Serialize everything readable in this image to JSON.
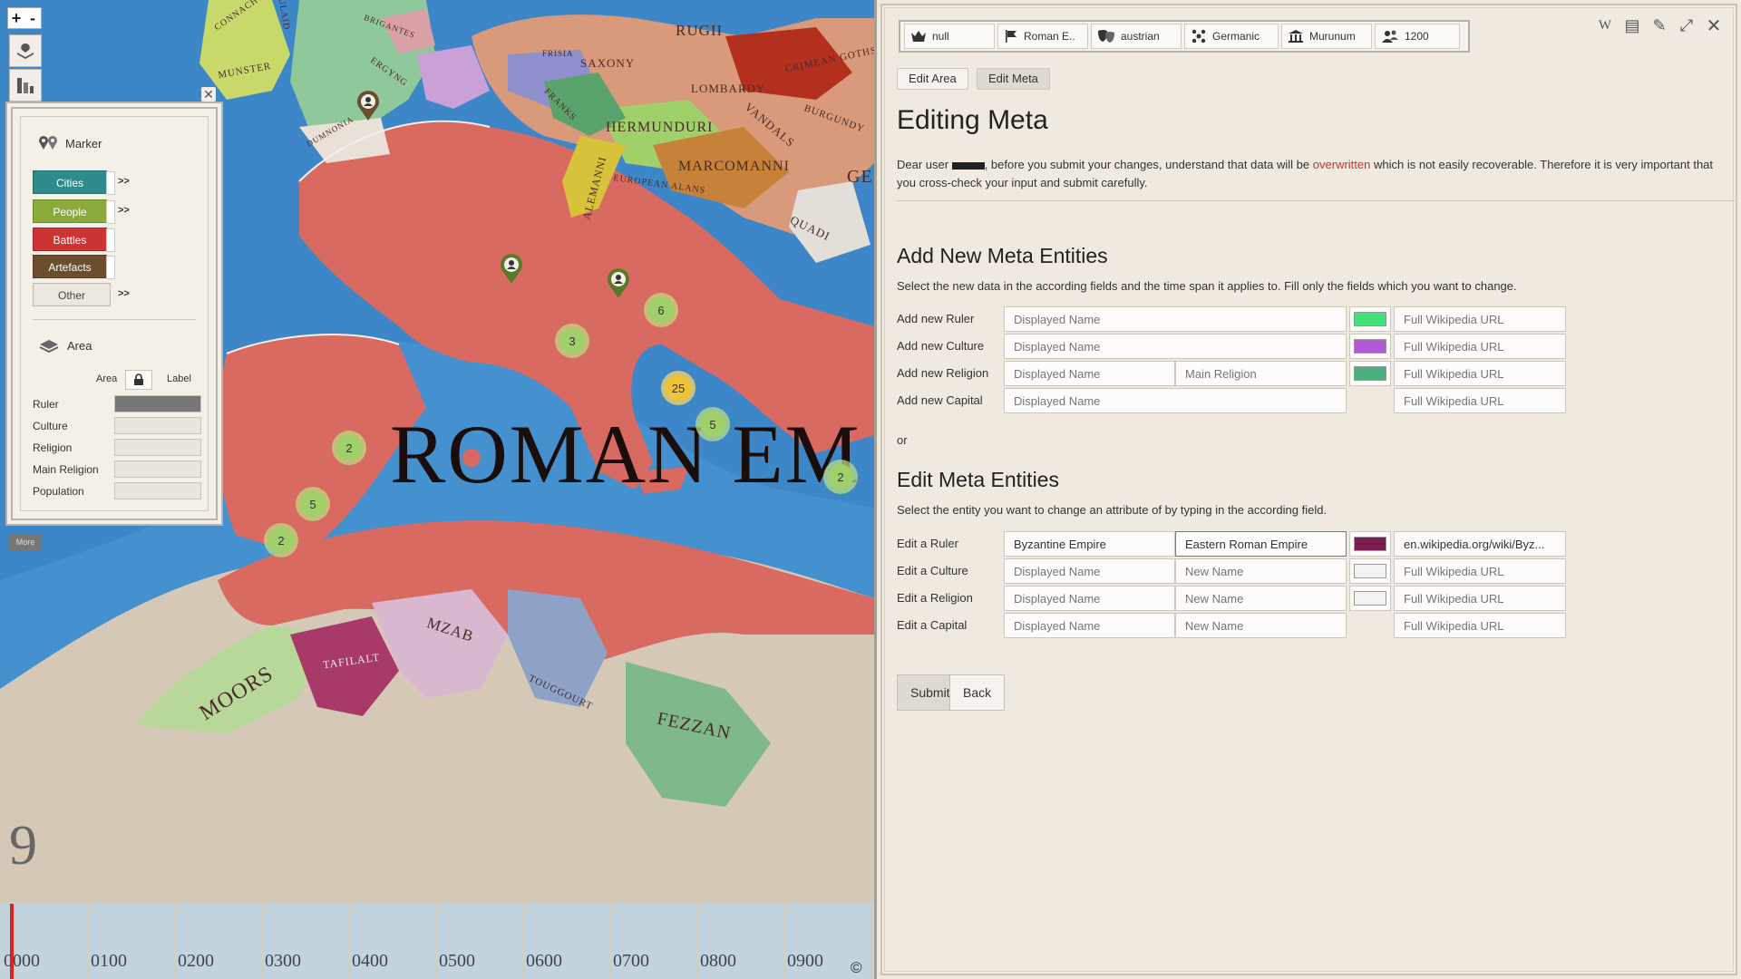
{
  "map": {
    "zoom_in": "+",
    "zoom_out": "-",
    "labels": [
      {
        "text": "ROMAN EM"
      },
      {
        "text": "RUGII"
      },
      {
        "text": "SAXONY"
      },
      {
        "text": "LOMBARDY"
      },
      {
        "text": "CRIMEAN GOTHS"
      },
      {
        "text": "HERMUNDURI"
      },
      {
        "text": "VANDALS"
      },
      {
        "text": "BURGUNDY"
      },
      {
        "text": "MARCOMANNI"
      },
      {
        "text": "ALEMANNI"
      },
      {
        "text": "EUROPEAN ALANS"
      },
      {
        "text": "QUADI"
      },
      {
        "text": "FRANKS"
      },
      {
        "text": "FRISIA"
      },
      {
        "text": "ERGYNG"
      },
      {
        "text": "MUNSTER"
      },
      {
        "text": "CONNACHT"
      },
      {
        "text": "BRIGANTES"
      },
      {
        "text": "DUMNONIA"
      },
      {
        "text": "ULAID"
      },
      {
        "text": "GE"
      },
      {
        "text": "MZAB"
      },
      {
        "text": "TAFILALT"
      },
      {
        "text": "MOORS"
      },
      {
        "text": "TOUGGOURT"
      },
      {
        "text": "FEZZAN"
      }
    ],
    "clusters": [
      {
        "count": "6"
      },
      {
        "count": "3"
      },
      {
        "count": "25"
      },
      {
        "count": "5"
      },
      {
        "count": "2"
      },
      {
        "count": "5"
      },
      {
        "count": "2"
      },
      {
        "count": "2"
      }
    ],
    "year": "9",
    "timeline_labels": [
      "0000",
      "0100",
      "0200",
      "0300",
      "0400",
      "0500",
      "0600",
      "0700",
      "0800",
      "0900"
    ],
    "copyright": "©",
    "more_label": "More"
  },
  "layers": {
    "marker_title": "Marker",
    "marker_buttons": [
      {
        "label": "Cities",
        "color": "#2e8b8b",
        "arrow": ">>"
      },
      {
        "label": "People",
        "color": "#8aab3c",
        "arrow": ">>"
      },
      {
        "label": "Battles",
        "color": "#cc3333",
        "arrow": ""
      },
      {
        "label": "Artefacts",
        "color": "#6b4e2e",
        "arrow": ""
      },
      {
        "label": "Other",
        "color": "#ebe7df",
        "arrow": ">>"
      }
    ],
    "area_title": "Area",
    "area_toggle_left": "Area",
    "area_toggle_right": "Label",
    "area_rows": [
      {
        "label": "Ruler"
      },
      {
        "label": "Culture"
      },
      {
        "label": "Religion"
      },
      {
        "label": "Main Religion"
      },
      {
        "label": "Population"
      }
    ]
  },
  "topbar": {
    "items": [
      {
        "icon": "crown-icon",
        "text": "null"
      },
      {
        "icon": "flag-icon",
        "text": "Roman E.."
      },
      {
        "icon": "theater-masks-icon",
        "text": "austrian"
      },
      {
        "icon": "culture-grid-icon",
        "text": "Germanic"
      },
      {
        "icon": "temple-icon",
        "text": "Murunum"
      },
      {
        "icon": "population-icon",
        "text": "1200"
      }
    ]
  },
  "window_icons": [
    "W",
    "▤",
    "✎",
    "⤢",
    "✕"
  ],
  "tabs": {
    "edit_area": "Edit Area",
    "edit_meta": "Edit Meta"
  },
  "page": {
    "title": "Editing Meta",
    "notice_pre": "Dear user",
    "notice_mid": ", before you submit your changes, understand that data will be",
    "notice_red": "overwritten",
    "notice_post": "which is not easily recoverable. Therefore it is very important that you cross-check your input and submit carefully.",
    "add_heading": "Add New Meta Entities",
    "add_desc": "Select the new data in the according fields and the time span it applies to. Fill only the fields which you want to change.",
    "or": "or",
    "edit_heading": "Edit Meta Entities",
    "edit_desc": "Select the entity you want to change an attribute of by typing in the according field."
  },
  "add_rows": [
    {
      "label": "Add new Ruler",
      "name_ph": "Displayed Name",
      "color": "#44e07a",
      "url_ph": "Full Wikipedia URL"
    },
    {
      "label": "Add new Culture",
      "name_ph": "Displayed Name",
      "color": "#b35ad6",
      "url_ph": "Full Wikipedia URL"
    },
    {
      "label": "Add new Religion",
      "name_ph": "Displayed Name",
      "main_ph": "Main Religion",
      "color": "#4caf80",
      "url_ph": "Full Wikipedia URL"
    },
    {
      "label": "Add new Capital",
      "name_ph": "Displayed Name",
      "url_ph": "Full Wikipedia URL"
    }
  ],
  "edit_rows": [
    {
      "label": "Edit a Ruler",
      "entity": "Byzantine Empire",
      "new_name": "Eastern Roman Empire",
      "color": "#7d1e52",
      "url": "en.wikipedia.org/wiki/Byz..."
    },
    {
      "label": "Edit a Culture",
      "entity_ph": "Displayed Name",
      "new_ph": "New Name",
      "color": "#f2f2f2",
      "url_ph": "Full Wikipedia URL"
    },
    {
      "label": "Edit a Religion",
      "entity_ph": "Displayed Name",
      "new_ph": "New Name",
      "color": "#f2f2f2",
      "url_ph": "Full Wikipedia URL"
    },
    {
      "label": "Edit a Capital",
      "entity_ph": "Displayed Name",
      "new_ph": "New Name",
      "url_ph": "Full Wikipedia URL"
    }
  ],
  "actions": {
    "submit": "Submit",
    "back": "Back"
  }
}
